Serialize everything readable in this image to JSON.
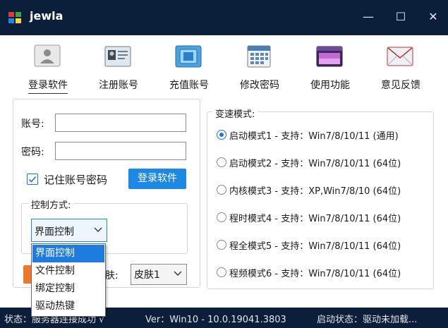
{
  "window": {
    "title": "jewla",
    "minimize_glyph": "—",
    "maximize_glyph": "☐",
    "close_glyph": "✕"
  },
  "toolbar": {
    "items": [
      {
        "label": "登录软件",
        "icon": "login-user-icon",
        "active": true
      },
      {
        "label": "注册账号",
        "icon": "register-id-card-icon",
        "active": false
      },
      {
        "label": "充值账号",
        "icon": "recharge-card-icon",
        "active": false
      },
      {
        "label": "修改密码",
        "icon": "change-password-calendar-icon",
        "active": false
      },
      {
        "label": "使用功能",
        "icon": "use-function-window-icon",
        "active": false
      },
      {
        "label": "意见反馈",
        "icon": "feedback-envelope-icon",
        "active": false
      }
    ]
  },
  "login": {
    "account_label": "账号:",
    "account_value": "",
    "password_label": "密码:",
    "password_value": "",
    "remember_label": "记住账号密码",
    "remember_checked": true,
    "login_button": "登录软件"
  },
  "control": {
    "group_title": "控制方式:",
    "selected": "界面控制",
    "options": [
      "界面控制",
      "文件控制",
      "绑定控制",
      "驱动热键"
    ]
  },
  "skin": {
    "label_partial": "肤:",
    "selected": "皮肤1"
  },
  "speed": {
    "group_title": "变速模式:",
    "modes": [
      {
        "label": "启动模式1 - 支持：Win7/8/10/11 (通用)",
        "checked": true
      },
      {
        "label": "启动模式2 - 支持：Win7/8/10/11 (64位)",
        "checked": false
      },
      {
        "label": "内核模式3 - 支持：XP,Win7/8/10 (64位)",
        "checked": false
      },
      {
        "label": "程时模式4 - 支持：Win7/8/10/11 (64位)",
        "checked": false
      },
      {
        "label": "程全模式5 - 支持：Win7/8/10/11 (64位)",
        "checked": false
      },
      {
        "label": "程频模式6 - 支持：Win7/8/10/11 (64位)",
        "checked": false
      }
    ]
  },
  "status": {
    "state": "状态：服务器连接成功 √",
    "version": "Ver：Win10 - 10.0.19041.3803",
    "launch": "启动状态：驱动未加载..."
  },
  "colors": {
    "titlebar": "#0b1f3a",
    "accent": "#1e88e5",
    "selection": "#1e7be0"
  }
}
